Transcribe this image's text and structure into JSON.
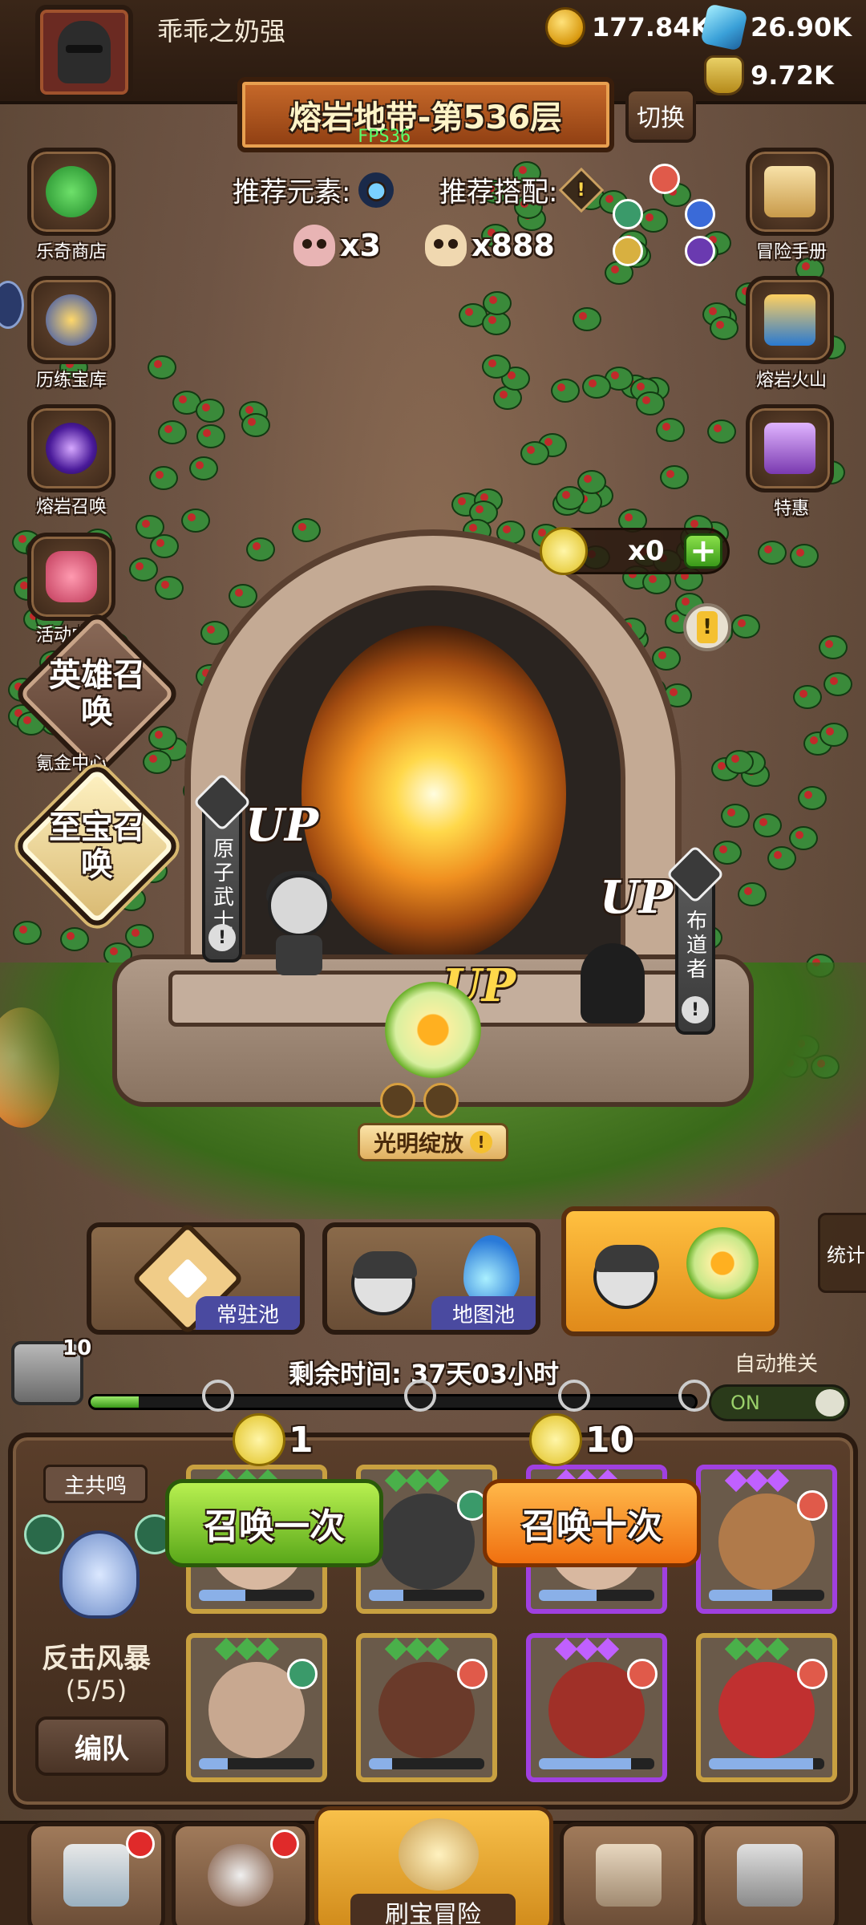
{
  "player": {
    "name": "乖乖之奶强"
  },
  "resources": {
    "gold": "177.84K",
    "gems": "26.90K",
    "potion": "9.72K"
  },
  "stage": {
    "title": "熔岩地带-第536层",
    "fps": "FPS36",
    "switch_label": "切换"
  },
  "recommend": {
    "element_label": "推荐元素:",
    "match_label": "推荐搭配:"
  },
  "counters": {
    "skull_a": "x3",
    "skull_b": "x888"
  },
  "left_menu": {
    "shop": "乐奇商店",
    "vault": "历练宝库",
    "lava_summon": "熔岩召唤",
    "event": "活动中心",
    "hero_summon": "英雄召唤",
    "krypton": "氪金中心",
    "treasure_summon": "至宝召唤"
  },
  "right_menu": {
    "handbook": "冒险手册",
    "volcano": "熔岩火山",
    "offer": "特惠"
  },
  "ticket": {
    "count": "x0",
    "plus": "+"
  },
  "portal": {
    "left_hero": "原子武士",
    "right_hero": "布道者",
    "up_label": "UP",
    "light_tag": "光明绽放",
    "info": "!"
  },
  "pools": {
    "normal": "常驻池",
    "map": "地图池",
    "stats": "统计"
  },
  "timer": {
    "chest_count": "10",
    "remaining": "剩余时间: 37天03小时",
    "auto_label": "自动推关",
    "toggle": "ON",
    "progress": 0.08
  },
  "summon": {
    "one_cost": "1",
    "ten_cost": "10",
    "one_label": "召唤一次",
    "ten_label": "召唤十次"
  },
  "resonance": {
    "title": "主共鸣",
    "name": "反击风暴",
    "count": "(5/5)",
    "team_button": "编队"
  },
  "bottom_nav": {
    "adventure": "刷宝冒险"
  },
  "colors": {
    "accent": "#f08a1a",
    "green_button": "#5aa81a",
    "orange_button": "#f07010"
  }
}
